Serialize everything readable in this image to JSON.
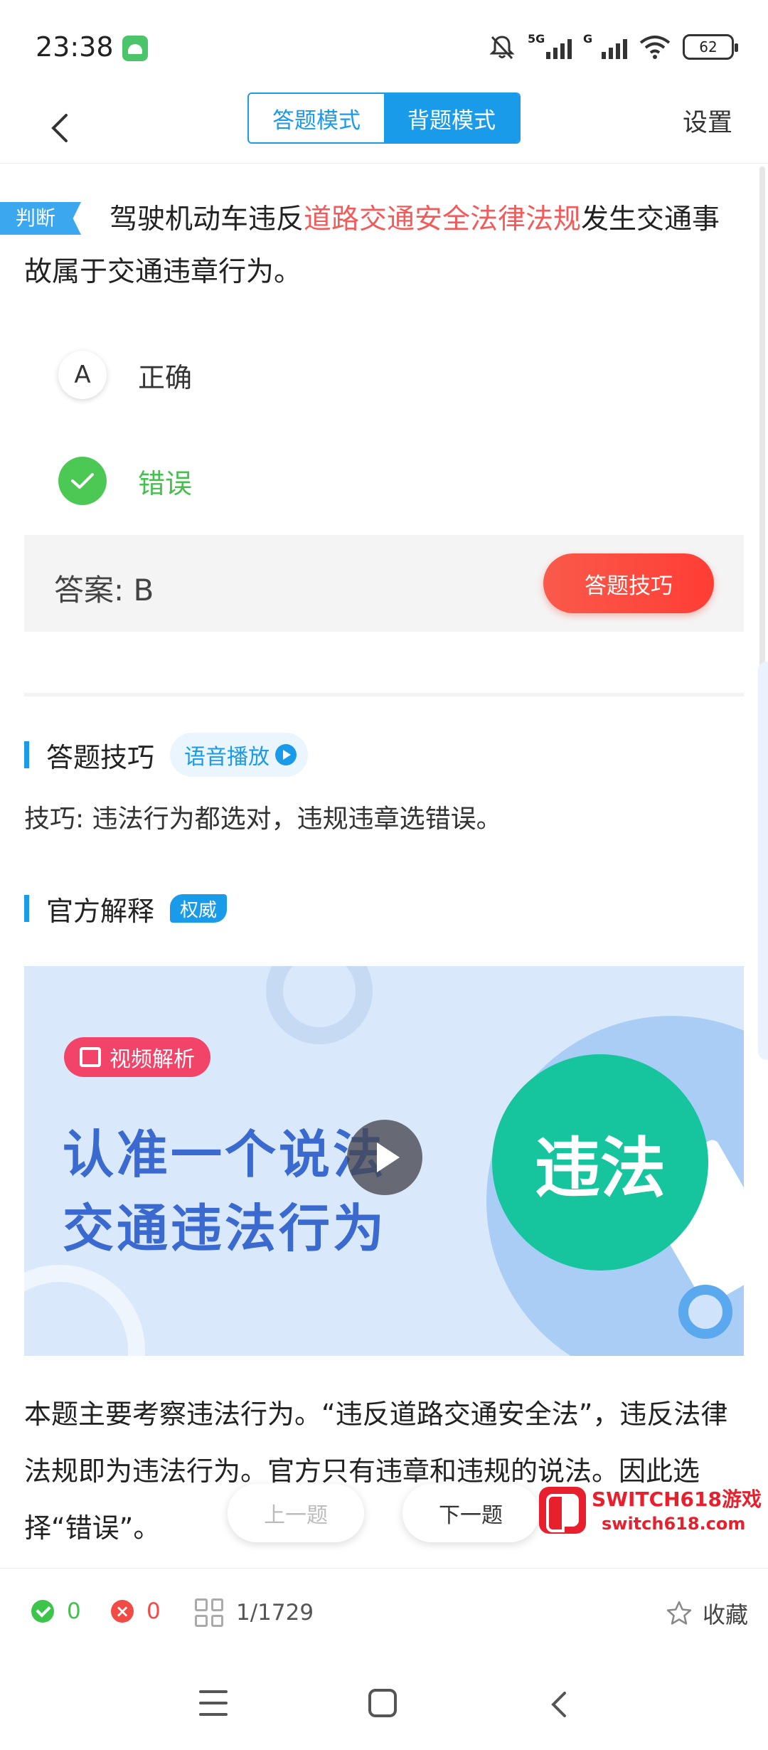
{
  "status_bar": {
    "time": "23:38",
    "signal_1_tag": "5G",
    "signal_2_tag": "G",
    "battery": "62",
    "icons": [
      "android-app-icon",
      "bell-muted-icon",
      "signal-icon",
      "wifi-icon",
      "battery-icon"
    ]
  },
  "nav": {
    "back_icon": "chevron-left-icon",
    "mode_answer": "答题模式",
    "mode_memorize": "背题模式",
    "active_mode": "背题模式",
    "settings": "设置"
  },
  "question": {
    "type_tag": "判断",
    "text_before": "驾驶机动车违反",
    "text_highlight": "道路交通安全法律法规",
    "text_after": "发生交通事故属于交通违章行为。",
    "options": [
      {
        "key": "A",
        "label": "正确",
        "state": "normal"
      },
      {
        "key": "B",
        "label": "错误",
        "state": "correct"
      }
    ],
    "answer": "答案: B",
    "tips_button": "答题技巧"
  },
  "tips_section": {
    "title": "答题技巧",
    "voice_button": "语音播放",
    "text": "技巧: 违法行为都选对，违规违章选错误。"
  },
  "official_section": {
    "title": "官方解释",
    "badge": "权威",
    "video": {
      "tag": "视频解析",
      "line1": "认准一个说法",
      "line2": "交通违法行为",
      "circle_text": "违法"
    },
    "explanation": "本题主要考察违法行为。“违反道路交通安全法”，违反法律法规即为违法行为。官方只有违章和违规的说法。因此选择“错误”。"
  },
  "pager": {
    "prev": "上一题",
    "next": "下一题"
  },
  "watermark": {
    "title": "SWITCH618游戏",
    "url": "switch618.com"
  },
  "bottom_bar": {
    "correct_count": "0",
    "wrong_count": "0",
    "progress": "1/1729",
    "favorite": "收藏"
  },
  "colors": {
    "accent": "#1a9bea",
    "highlight": "#f35a5a",
    "correct": "#45c04f",
    "wrong": "#f24a44",
    "tips_button": "#ff3d35",
    "video_bg": "#d9e8fb",
    "video_circle": "#16c49e"
  }
}
